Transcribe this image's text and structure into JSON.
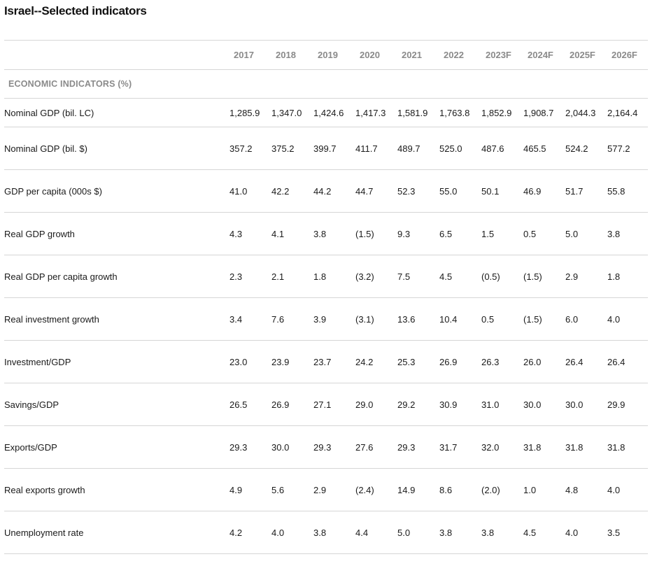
{
  "title": "Israel--Selected indicators",
  "columns": [
    "2017",
    "2018",
    "2019",
    "2020",
    "2021",
    "2022",
    "2023F",
    "2024F",
    "2025F",
    "2026F"
  ],
  "section_label": "ECONOMIC INDICATORS (%)",
  "rows": [
    {
      "label": "Nominal GDP (bil. LC)",
      "values": [
        "1,285.9",
        "1,347.0",
        "1,424.6",
        "1,417.3",
        "1,581.9",
        "1,763.8",
        "1,852.9",
        "1,908.7",
        "2,044.3",
        "2,164.4"
      ]
    },
    {
      "label": "Nominal GDP (bil. $)",
      "values": [
        "357.2",
        "375.2",
        "399.7",
        "411.7",
        "489.7",
        "525.0",
        "487.6",
        "465.5",
        "524.2",
        "577.2"
      ]
    },
    {
      "label": "GDP per capita (000s $)",
      "values": [
        "41.0",
        "42.2",
        "44.2",
        "44.7",
        "52.3",
        "55.0",
        "50.1",
        "46.9",
        "51.7",
        "55.8"
      ]
    },
    {
      "label": "Real GDP growth",
      "values": [
        "4.3",
        "4.1",
        "3.8",
        "(1.5)",
        "9.3",
        "6.5",
        "1.5",
        "0.5",
        "5.0",
        "3.8"
      ]
    },
    {
      "label": "Real GDP per capita growth",
      "values": [
        "2.3",
        "2.1",
        "1.8",
        "(3.2)",
        "7.5",
        "4.5",
        "(0.5)",
        "(1.5)",
        "2.9",
        "1.8"
      ]
    },
    {
      "label": "Real investment growth",
      "values": [
        "3.4",
        "7.6",
        "3.9",
        "(3.1)",
        "13.6",
        "10.4",
        "0.5",
        "(1.5)",
        "6.0",
        "4.0"
      ]
    },
    {
      "label": "Investment/GDP",
      "values": [
        "23.0",
        "23.9",
        "23.7",
        "24.2",
        "25.3",
        "26.9",
        "26.3",
        "26.0",
        "26.4",
        "26.4"
      ]
    },
    {
      "label": "Savings/GDP",
      "values": [
        "26.5",
        "26.9",
        "27.1",
        "29.0",
        "29.2",
        "30.9",
        "31.0",
        "30.0",
        "30.0",
        "29.9"
      ]
    },
    {
      "label": "Exports/GDP",
      "values": [
        "29.3",
        "30.0",
        "29.3",
        "27.6",
        "29.3",
        "31.7",
        "32.0",
        "31.8",
        "31.8",
        "31.8"
      ]
    },
    {
      "label": "Real exports growth",
      "values": [
        "4.9",
        "5.6",
        "2.9",
        "(2.4)",
        "14.9",
        "8.6",
        "(2.0)",
        "1.0",
        "4.8",
        "4.0"
      ]
    },
    {
      "label": "Unemployment rate",
      "values": [
        "4.2",
        "4.0",
        "3.8",
        "4.4",
        "5.0",
        "3.8",
        "3.8",
        "4.5",
        "4.0",
        "3.5"
      ]
    }
  ]
}
